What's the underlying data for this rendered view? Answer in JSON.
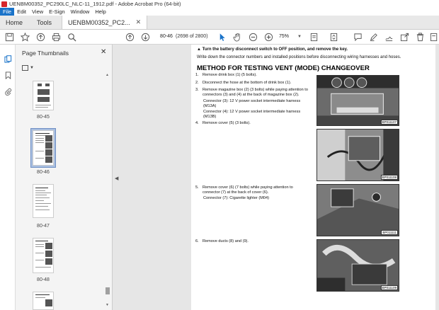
{
  "window": {
    "title": "UENBM00352_PC290LC_NLC-11_1912.pdf - Adobe Acrobat Pro (64-bit)"
  },
  "menu": [
    "File",
    "Edit",
    "View",
    "E-Sign",
    "Window",
    "Help"
  ],
  "tabs": {
    "home": "Home",
    "tools": "Tools",
    "document": "UENBM00352_PC2..."
  },
  "toolbar": {
    "current_page": "80-46",
    "page_count": "(2698 of 2800)",
    "zoom": "75%"
  },
  "thumbnails": {
    "title": "Page Thumbnails",
    "pages": [
      "80-45",
      "80-46",
      "80-47",
      "80-48"
    ],
    "selected": "80-46"
  },
  "document": {
    "warning": "Turn the battery disconnect switch to OFF position, and remove the key.",
    "note": "Write down the connector numbers and installed positions before disconnecting wiring harnesses and hoses.",
    "heading": "METHOD FOR TESTING VENT (MODE) CHANGEOVER",
    "steps": [
      {
        "num": "1.",
        "text": "Remove drink box (1) (5 bolts)."
      },
      {
        "num": "2.",
        "text": "Disconnect the hose at the bottom of drink box (1)."
      },
      {
        "num": "3.",
        "text": "Remove magazine box (2) (3 bolts) while paying attention to connectors (3) and (4) at the back of magazine box (2)."
      },
      {
        "num": "4.",
        "text": "Remove cover (5) (3 bolts)."
      },
      {
        "num": "5.",
        "text": "Remove cover (6) (7 bolts) while paying attention to connector (7) at the back of cover (6)."
      },
      {
        "num": "6.",
        "text": "Remove ducts (8) and (9)."
      }
    ],
    "connector3": "Connector (3): 12 V power socket intermediate harness (M13A)",
    "connector4": "Connector (4): 12 V power socket intermediate harness (M13B)",
    "connector7": "Connector (7): Cigarette lighter (M04)",
    "photo_codes": [
      "BP011107",
      "BP011108",
      "BP011111",
      "BP011109"
    ]
  }
}
